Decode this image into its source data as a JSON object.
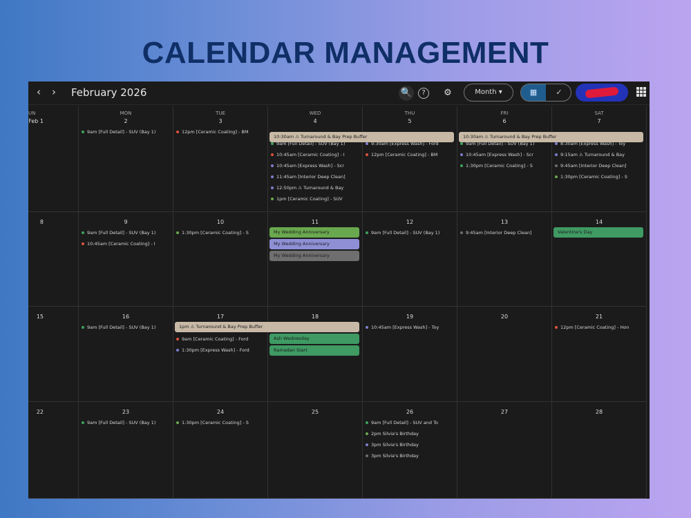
{
  "page": {
    "heading": "CALENDAR MANAGEMENT"
  },
  "toolbar": {
    "prev": "‹",
    "next": "›",
    "title": "February 2026",
    "search_icon": "🔍",
    "help_icon": "?",
    "settings_icon": "⚙",
    "view": "Month ▾",
    "calendar_icon": "▦",
    "tasks_icon": "✓"
  },
  "colors": {
    "sand": "#c8b9a6",
    "green": "#6aa84f",
    "lavender": "#8f8fd6",
    "gray": "#6f6f6f",
    "teal": "#3f9a63"
  },
  "days": [
    {
      "dow": "SUN",
      "num": "Feb 1",
      "events": []
    },
    {
      "dow": "MON",
      "num": "2",
      "events": [
        {
          "t": "9am [Full Detail] - SUV (Bay 1)",
          "c": "#3fa35c"
        }
      ]
    },
    {
      "dow": "TUE",
      "num": "3",
      "events": [
        {
          "t": "12pm [Ceramic Coating] - BM",
          "c": "#e0533c"
        }
      ]
    },
    {
      "dow": "WED",
      "num": "4",
      "events": [
        {
          "t": "9am [Full Detail] - SUV (Bay 1)",
          "c": "#3fa35c"
        },
        {
          "t": "10:45am [Ceramic Coating] - I",
          "c": "#e0533c"
        },
        {
          "t": "10:45am [Express Wash] - Scr",
          "c": "#7f7fd0"
        },
        {
          "t": "11:45am [Interior Deep Clean]",
          "c": "#7f7fd0"
        },
        {
          "t": "12:50pm ⚠ Turnaround & Bay",
          "c": "#7f7fd0"
        },
        {
          "t": "1pm [Ceramic Coating] - SUV",
          "c": "#6aa84f"
        }
      ]
    },
    {
      "dow": "THU",
      "num": "5",
      "events": [
        {
          "t": "9:30am [Express Wash] - Ford",
          "c": "#7f7fd0"
        },
        {
          "t": "12pm [Ceramic Coating] - BM",
          "c": "#e0533c"
        }
      ]
    },
    {
      "dow": "FRI",
      "num": "6",
      "events": [
        {
          "t": "9am [Full Detail] - SUV (Bay 1)",
          "c": "#3fa35c"
        },
        {
          "t": "10:45am [Express Wash] - Scr",
          "c": "#7f7fd0"
        },
        {
          "t": "1:30pm [Ceramic Coating] - S",
          "c": "#3fa35c"
        }
      ]
    },
    {
      "dow": "SAT",
      "num": "7",
      "events": [
        {
          "t": "8:30am [Express Wash] - Toy",
          "c": "#7f7fd0"
        },
        {
          "t": "9:15am ⚠ Turnaround & Bay",
          "c": "#7f7fd0"
        },
        {
          "t": "9:45am [Interior Deep Clean]",
          "c": "#6f6f6f"
        },
        {
          "t": "1:30pm [Ceramic Coating] - S",
          "c": "#6aa84f"
        }
      ]
    },
    {
      "dow": "",
      "num": "8",
      "events": []
    },
    {
      "dow": "",
      "num": "9",
      "events": [
        {
          "t": "9am [Full Detail] - SUV (Bay 1)",
          "c": "#3fa35c"
        },
        {
          "t": "10:45am [Ceramic Coating] - I",
          "c": "#e0533c"
        }
      ]
    },
    {
      "dow": "",
      "num": "10",
      "events": [
        {
          "t": "1:30pm [Ceramic Coating] - S",
          "c": "#6aa84f"
        }
      ]
    },
    {
      "dow": "",
      "num": "11",
      "events": []
    },
    {
      "dow": "",
      "num": "12",
      "events": [
        {
          "t": "9am [Full Detail] - SUV (Bay 1)",
          "c": "#3fa35c"
        }
      ]
    },
    {
      "dow": "",
      "num": "13",
      "events": [
        {
          "t": "9:45am [Interior Deep Clean]",
          "c": "#6f6f6f"
        }
      ]
    },
    {
      "dow": "",
      "num": "14",
      "events": []
    },
    {
      "dow": "",
      "num": "15",
      "events": []
    },
    {
      "dow": "",
      "num": "16",
      "events": [
        {
          "t": "9am [Full Detail] - SUV (Bay 1)",
          "c": "#3fa35c"
        }
      ]
    },
    {
      "dow": "",
      "num": "17",
      "events": [
        {
          "t": "9am [Ceramic Coating] - Ford",
          "c": "#e0533c"
        },
        {
          "t": "1:30pm [Express Wash] - Ford",
          "c": "#7f7fd0"
        }
      ]
    },
    {
      "dow": "",
      "num": "18",
      "events": []
    },
    {
      "dow": "",
      "num": "19",
      "events": [
        {
          "t": "10:45am [Express Wash] - Toy",
          "c": "#7f7fd0"
        }
      ]
    },
    {
      "dow": "",
      "num": "20",
      "events": []
    },
    {
      "dow": "",
      "num": "21",
      "events": [
        {
          "t": "12pm [Ceramic Coating] - Hon",
          "c": "#e0533c"
        }
      ]
    },
    {
      "dow": "",
      "num": "22",
      "events": []
    },
    {
      "dow": "",
      "num": "23",
      "events": [
        {
          "t": "9am [Full Detail] - SUV (Bay 1)",
          "c": "#3fa35c"
        }
      ]
    },
    {
      "dow": "",
      "num": "24",
      "events": [
        {
          "t": "1:30pm [Ceramic Coating] - S",
          "c": "#6aa84f"
        }
      ]
    },
    {
      "dow": "",
      "num": "25",
      "events": []
    },
    {
      "dow": "",
      "num": "26",
      "events": [
        {
          "t": "9am [Full Detail] - SUV and To",
          "c": "#3fa35c"
        },
        {
          "t": "2pm Silvia's Birthday",
          "c": "#6aa84f"
        },
        {
          "t": "3pm Silvia's Birthday",
          "c": "#7f7fd0"
        },
        {
          "t": "3pm Silvia's Birthday",
          "c": "#6f6f6f"
        }
      ]
    },
    {
      "dow": "",
      "num": "27",
      "events": []
    },
    {
      "dow": "",
      "num": "28",
      "events": []
    }
  ],
  "bars": [
    {
      "week": 0,
      "start": 3,
      "span": 2,
      "slot": 0,
      "t": "10:30am ⚠ Turnaround & Bay Prep Buffer",
      "c": "#c8b9a6"
    },
    {
      "week": 0,
      "start": 5,
      "span": 2,
      "slot": 0,
      "t": "10:30am ⚠ Turnaround & Bay Prep Buffer",
      "c": "#c8b9a6"
    },
    {
      "week": 1,
      "start": 3,
      "span": 1,
      "slot": 0,
      "t": "My Wedding Anniversary",
      "c": "#6aa84f"
    },
    {
      "week": 1,
      "start": 3,
      "span": 1,
      "slot": 1,
      "t": "My Wedding Anniversary",
      "c": "#8f8fd6"
    },
    {
      "week": 1,
      "start": 3,
      "span": 1,
      "slot": 2,
      "t": "My Wedding Anniversary",
      "c": "#6f6f6f"
    },
    {
      "week": 1,
      "start": 6,
      "span": 1,
      "slot": 0,
      "t": "Valentine's Day",
      "c": "#3f9a63"
    },
    {
      "week": 2,
      "start": 2,
      "span": 2,
      "slot": 0,
      "t": "1pm ⚠ Turnaround & Bay Prep Buffer",
      "c": "#c8b9a6"
    },
    {
      "week": 2,
      "start": 3,
      "span": 1,
      "slot": 1,
      "t": "Ash Wednesday",
      "c": "#3f9a63"
    },
    {
      "week": 2,
      "start": 3,
      "span": 1,
      "slot": 2,
      "t": "Ramadan Start",
      "c": "#3f9a63"
    }
  ]
}
